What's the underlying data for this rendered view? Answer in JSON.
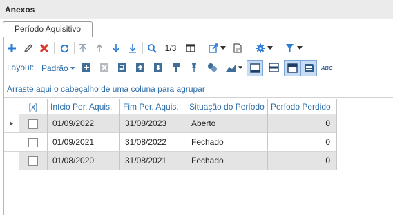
{
  "window": {
    "title": "Anexos"
  },
  "tabs": [
    {
      "label": "Período Aquisitivo",
      "active": true
    }
  ],
  "toolbar": {
    "page_indicator": "1/3",
    "buttons": [
      {
        "name": "add-icon",
        "color": "#2b7bd6"
      },
      {
        "name": "edit-icon",
        "color": "#555555"
      },
      {
        "name": "delete-icon",
        "color": "#d63a2a"
      },
      {
        "name": "refresh-icon",
        "color": "#2b7bd6"
      },
      {
        "name": "move-first-icon",
        "color": "#9aa6b2"
      },
      {
        "name": "move-up-icon",
        "color": "#9aa6b2"
      },
      {
        "name": "move-down-icon",
        "color": "#2b7bd6"
      },
      {
        "name": "move-last-icon",
        "color": "#2b7bd6"
      },
      {
        "name": "search-icon",
        "color": "#2b7bd6"
      },
      {
        "name": "columns-icon",
        "color": "#333333"
      },
      {
        "name": "export-icon",
        "color": "#2b7bd6"
      },
      {
        "name": "document-icon",
        "color": "#555555"
      },
      {
        "name": "settings-icon",
        "color": "#2b7bd6"
      },
      {
        "name": "filter-icon",
        "color": "#2b7bd6"
      }
    ]
  },
  "layout_bar": {
    "label": "Layout:",
    "layout_select": "Padrão",
    "buttons": [
      "add-row-icon",
      "remove-row-icon",
      "insert-row-icon",
      "move-row-up-icon",
      "move-row-down-icon",
      "paint-format-icon",
      "pin-icon",
      "shapes-icon",
      "chart-icon",
      "row-style-1-icon",
      "row-style-2-icon",
      "row-style-3-icon",
      "row-style-4-icon",
      "abc-text-icon"
    ]
  },
  "group_zone": {
    "text": "Arraste aqui o cabeçalho de uma coluna para agrupar"
  },
  "grid": {
    "columns": [
      "[x]",
      "Início Per. Aquis.",
      "Fim Per. Aquis.",
      "Situação do Período",
      "Período Perdido"
    ],
    "rows": [
      {
        "checked": false,
        "inicio": "01/09/2022",
        "fim": "31/08/2023",
        "situacao": "Aberto",
        "perdido": "0"
      },
      {
        "checked": false,
        "inicio": "01/09/2021",
        "fim": "31/08/2022",
        "situacao": "Fechado",
        "perdido": "0"
      },
      {
        "checked": false,
        "inicio": "01/08/2020",
        "fim": "31/08/2021",
        "situacao": "Fechado",
        "perdido": "0"
      }
    ]
  }
}
